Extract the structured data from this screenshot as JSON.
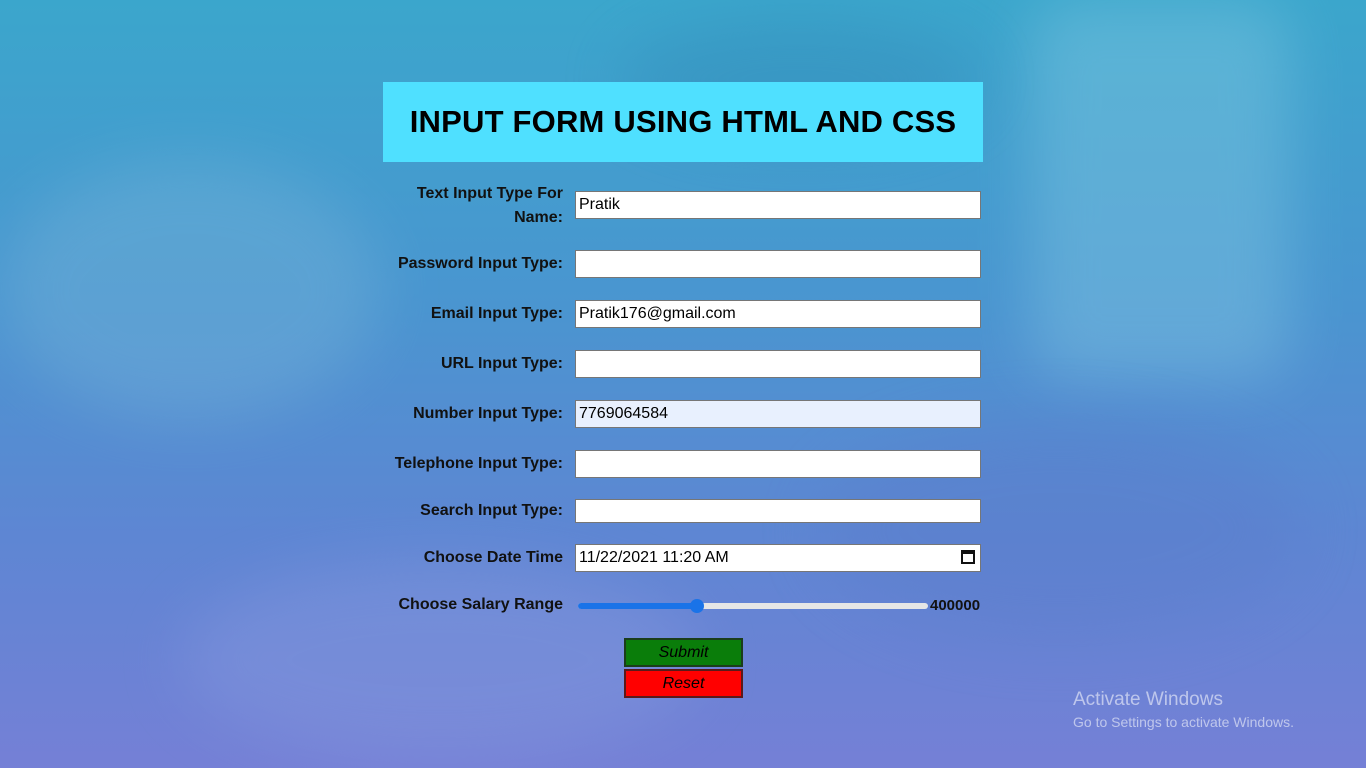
{
  "form": {
    "title": "INPUT FORM USING HTML AND CSS",
    "fields": [
      {
        "label": "Text Input Type For Name:",
        "value": "Pratik",
        "type": "text"
      },
      {
        "label": "Password Input Type:",
        "value": "",
        "type": "password"
      },
      {
        "label": "Email Input Type:",
        "value": "Pratik176@gmail.com",
        "type": "email"
      },
      {
        "label": "URL Input Type:",
        "value": "",
        "type": "url"
      },
      {
        "label": "Number Input Type:",
        "value": "7769064584",
        "type": "number"
      },
      {
        "label": "Telephone Input Type:",
        "value": "",
        "type": "tel"
      },
      {
        "label": "Search Input Type:",
        "value": "",
        "type": "search"
      },
      {
        "label": "Choose Date Time",
        "value": "11/22/2021 11:20  AM",
        "type": "datetime-local",
        "icon": "calendar-icon"
      }
    ],
    "salary": {
      "label": "Choose Salary Range",
      "value": "400000",
      "fraction": 0.34
    },
    "buttons": {
      "submit": "Submit",
      "reset": "Reset"
    },
    "colors": {
      "title_bg": "#4fe0ff",
      "submit_bg": "#0a7d0a",
      "reset_bg": "#ff0000",
      "slider_accent": "#1a73e8"
    }
  },
  "watermark": {
    "title": "Activate Windows",
    "subtitle": "Go to Settings to activate Windows."
  }
}
